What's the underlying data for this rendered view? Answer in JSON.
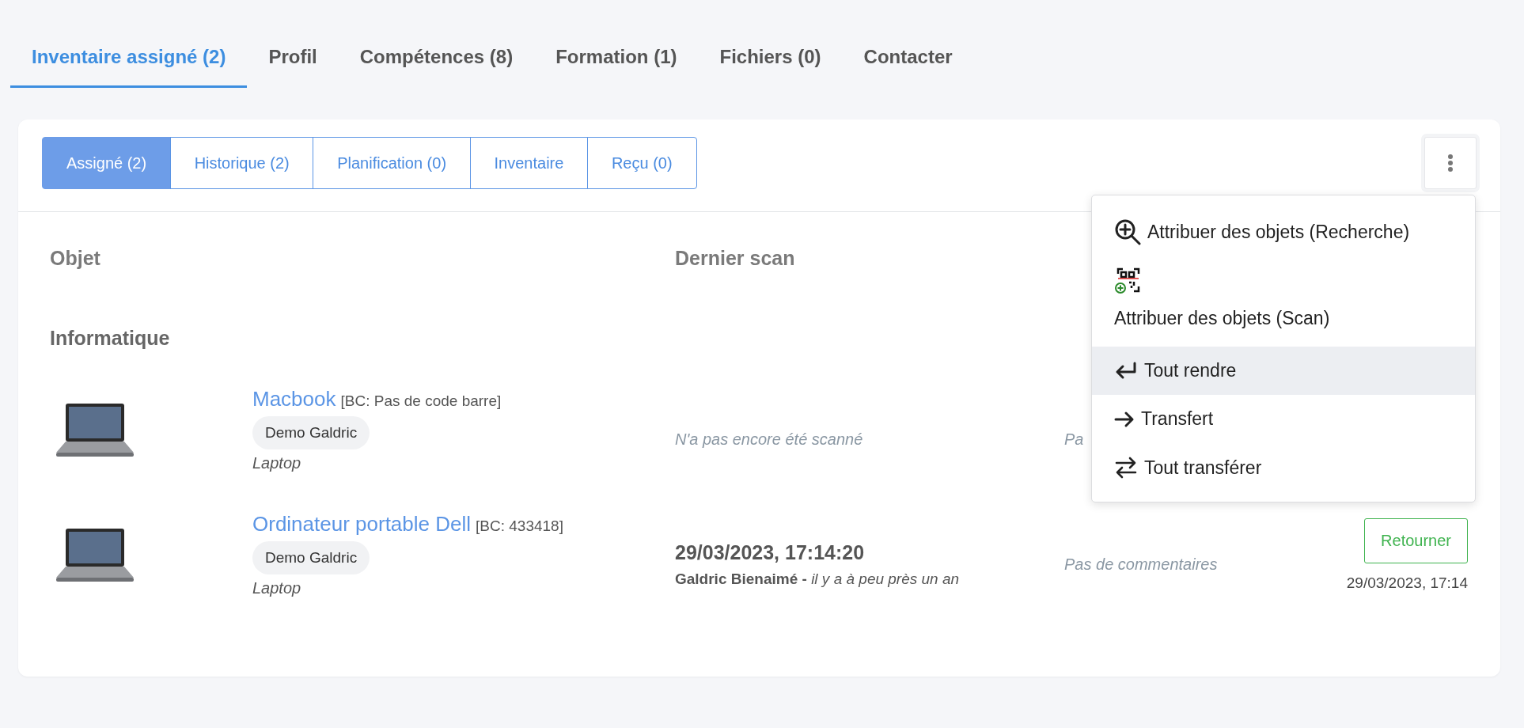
{
  "tabs": [
    {
      "label": "Inventaire assigné (2)",
      "selected": true
    },
    {
      "label": "Profil",
      "selected": false
    },
    {
      "label": "Compétences (8)",
      "selected": false
    },
    {
      "label": "Formation (1)",
      "selected": false
    },
    {
      "label": "Fichiers (0)",
      "selected": false
    },
    {
      "label": "Contacter",
      "selected": false
    }
  ],
  "subtabs": [
    {
      "label": "Assigné (2)",
      "selected": true
    },
    {
      "label": "Historique (2)",
      "selected": false
    },
    {
      "label": "Planification (0)",
      "selected": false
    },
    {
      "label": "Inventaire",
      "selected": false
    },
    {
      "label": "Reçu (0)",
      "selected": false
    }
  ],
  "table": {
    "columns": [
      "Objet",
      "Dernier scan"
    ],
    "group": "Informatique",
    "rows": [
      {
        "name": "Macbook",
        "barcode": "[BC: Pas de code barre]",
        "owner": "Demo Galdric",
        "category": "Laptop",
        "scan_note": "N'a pas encore été scanné",
        "comment": "Pa"
      },
      {
        "name": "Ordinateur portable Dell",
        "barcode": "[BC: 433418]",
        "owner": "Demo Galdric",
        "category": "Laptop",
        "scan_date": "29/03/2023, 17:14:20",
        "scan_by": "**Galdric Bienaimé -** *il y a à peu près un an*",
        "comment": "Pas de commentaires",
        "action": {
          "button": "Retourner",
          "date": "29/03/2023, 17:14"
        }
      }
    ]
  },
  "menu": {
    "items": [
      {
        "kind": "search",
        "label": "Attribuer des objets (Recherche)",
        "highlighted": false
      },
      {
        "kind": "scan",
        "label": "Attribuer des objets (Scan)",
        "highlighted": false
      },
      {
        "kind": "return",
        "label": "Tout rendre",
        "highlighted": true
      },
      {
        "kind": "arrow",
        "label": "Transfert",
        "highlighted": false
      },
      {
        "kind": "swap",
        "label": "Tout transférer",
        "highlighted": false
      }
    ]
  }
}
